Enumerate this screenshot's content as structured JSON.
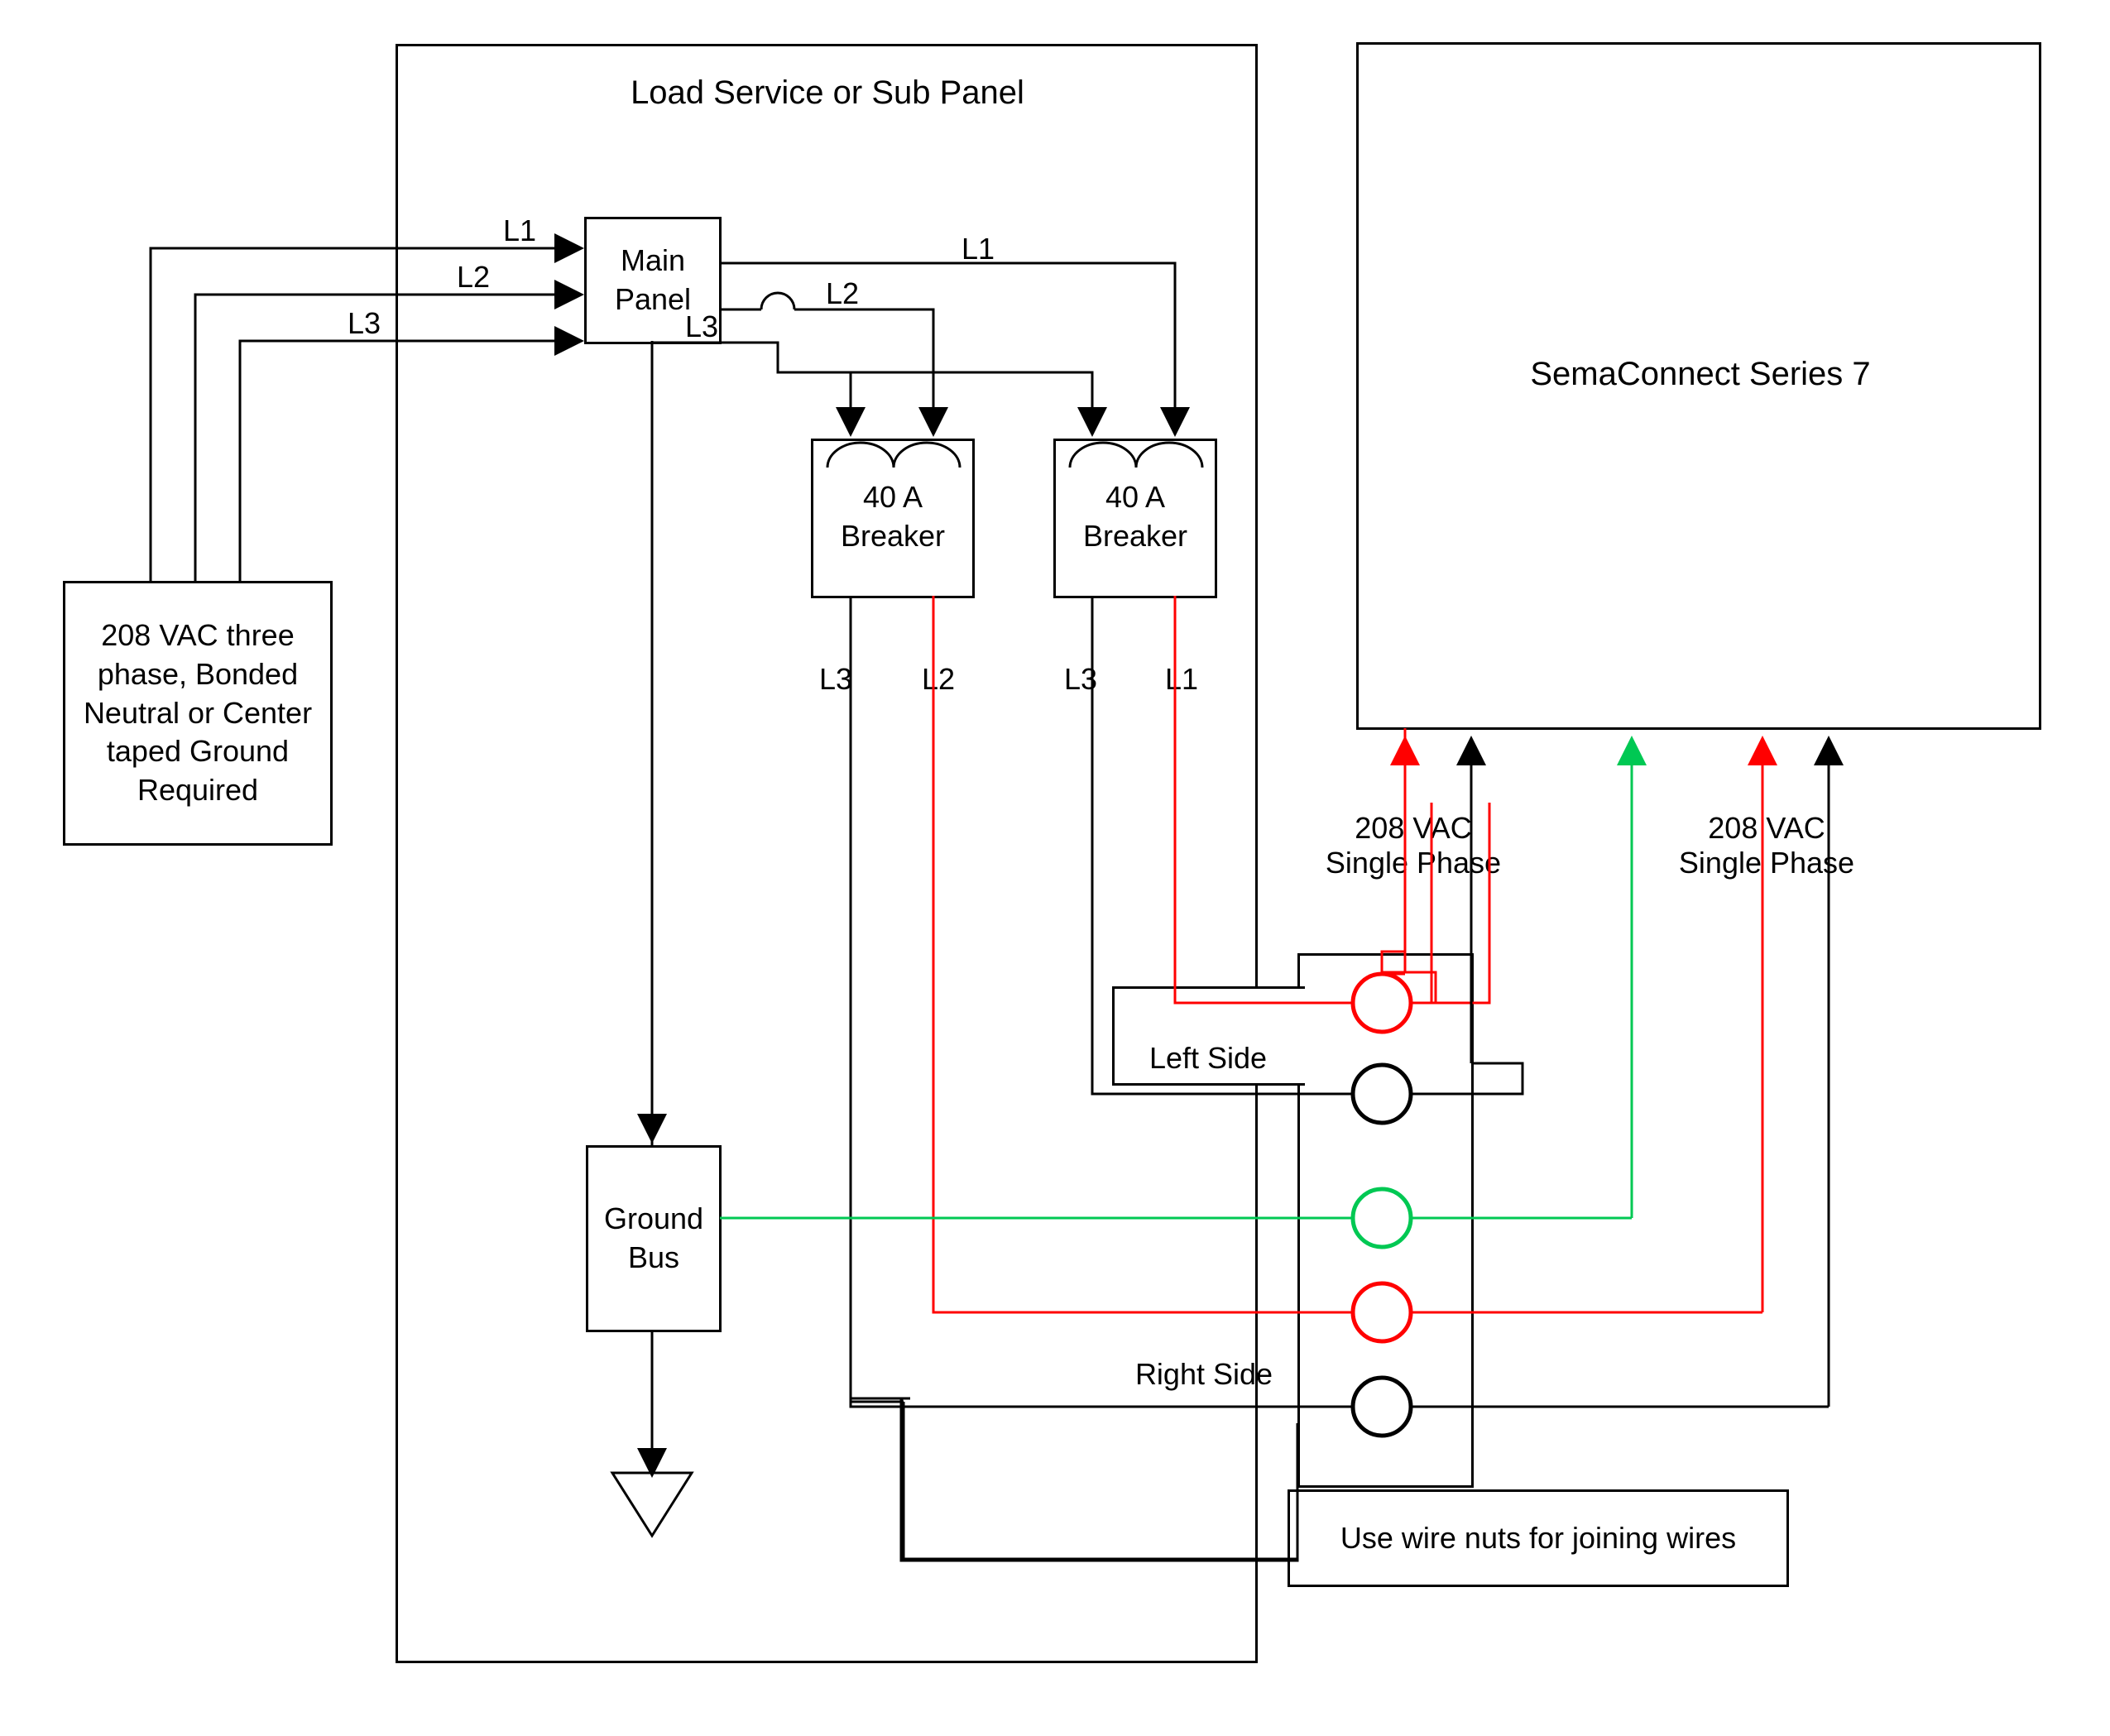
{
  "source_box": {
    "line1": "208 VAC three",
    "line2": "phase, Bonded",
    "line3": "Neutral or Center",
    "line4": "taped Ground",
    "line5": "Required"
  },
  "panel_title": "Load Service or Sub Panel",
  "main_panel": {
    "line1": "Main",
    "line2": "Panel"
  },
  "breaker1": {
    "line1": "40 A",
    "line2": "Breaker"
  },
  "breaker2": {
    "line1": "40 A",
    "line2": "Breaker"
  },
  "ground_bus": {
    "line1": "Ground",
    "line2": "Bus"
  },
  "device_title": "SemaConnect Series 7",
  "left_side": "Left Side",
  "right_side": "Right Side",
  "wire_nuts": "Use wire nuts for joining wires",
  "phase_left": {
    "line1": "208 VAC",
    "line2": "Single Phase"
  },
  "phase_right": {
    "line1": "208 VAC",
    "line2": "Single Phase"
  },
  "labels": {
    "l1_a": "L1",
    "l2_a": "L2",
    "l3_a": "L3",
    "l1_b": "L1",
    "l2_b": "L2",
    "l3_b": "L3",
    "l3_c": "L3",
    "l2_c": "L2",
    "l3_d": "L3",
    "l1_c": "L1"
  }
}
